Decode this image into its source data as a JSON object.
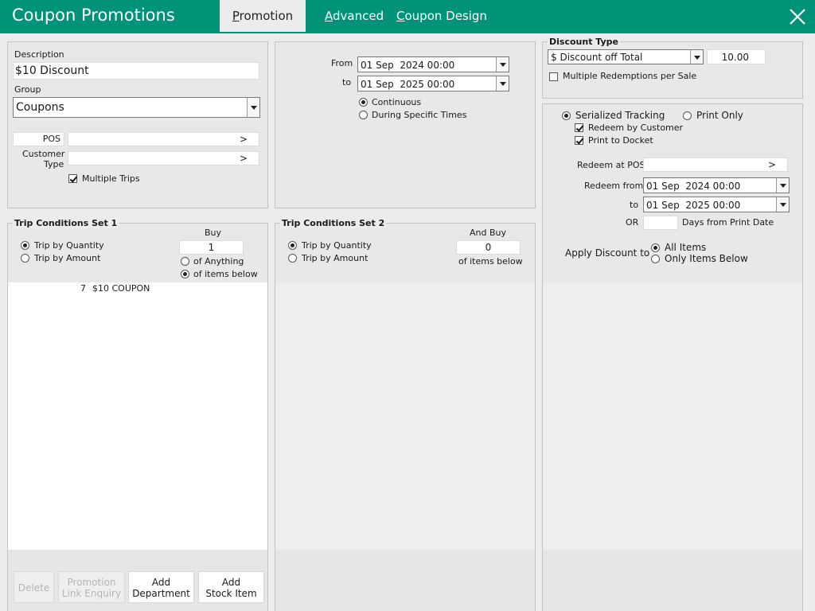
{
  "window": {
    "title": "Coupon Promotions"
  },
  "tabs": [
    {
      "label_key": "P",
      "label_rest": "romotion"
    },
    {
      "label_key": "A",
      "label_rest": "dvanced"
    },
    {
      "label_key": "C",
      "label_rest": "oupon Design"
    }
  ],
  "general": {
    "description_label": "Description",
    "description_value": "$10 Discount",
    "group_label": "Group",
    "group_value": "Coupons",
    "pos_label": "POS",
    "pos_value": "",
    "customer_type_label_1": "Customer",
    "customer_type_label_2": "Type",
    "customer_type_value": "",
    "chevron": ">",
    "multiple_trips_label": "Multiple Trips"
  },
  "dates": {
    "from_label": "From",
    "from_value": "01 Sep  2024 00:00",
    "to_label": "to",
    "to_value": "01 Sep  2025 00:00",
    "continuous_label": "Continuous",
    "specific_times_label": "During Specific Times"
  },
  "discount": {
    "title": "Discount Type",
    "type_value": "$ Discount off Total",
    "amount_value": "10.00",
    "multiple_redemptions_label": "Multiple Redemptions per Sale"
  },
  "tracking": {
    "serialized_label": "Serialized Tracking",
    "print_only_label": "Print Only",
    "redeem_by_customer_label": "Redeem by Customer",
    "print_to_docket_label": "Print to Docket",
    "redeem_at_pos_label": "Redeem at POS",
    "redeem_at_pos_value": "",
    "redeem_at_pos_chevron": ">",
    "redeem_from_label": "Redeem from",
    "redeem_from_value": "01 Sep  2024 00:00",
    "redeem_to_label": "to",
    "redeem_to_value": "01 Sep  2025 00:00",
    "or_label": "OR",
    "days_value": "",
    "days_label": "Days from Print Date",
    "apply_discount_label": "Apply Discount to",
    "all_items_label": "All Items",
    "only_items_below_label": "Only Items Below"
  },
  "trip1": {
    "title": "Trip Conditions Set 1",
    "by_quantity_label": "Trip by Quantity",
    "by_amount_label": "Trip by Amount",
    "buy_label": "Buy",
    "buy_value": "1",
    "of_anything_label": "of Anything",
    "of_items_below_label": "of items below",
    "items": [
      {
        "code": "7",
        "name": "$10 COUPON"
      }
    ]
  },
  "trip2": {
    "title": "Trip Conditions Set 2",
    "by_quantity_label": "Trip by Quantity",
    "by_amount_label": "Trip by Amount",
    "and_buy_label": "And Buy",
    "and_buy_value": "0",
    "of_items_below_label": "of items below"
  },
  "buttons": {
    "delete_label": "Delete",
    "link_enquiry_line1": "Promotion",
    "link_enquiry_line2": "Link Enquiry",
    "add_department_line1": "Add",
    "add_department_line2": "Department",
    "add_stock_line1": "Add",
    "add_stock_line2": "Stock Item"
  },
  "colors": {
    "titlebar": "#00937a",
    "panel": "#e8e8e8"
  },
  "icons": {
    "close": "close-icon",
    "dropdown": "chevron-down-icon"
  }
}
